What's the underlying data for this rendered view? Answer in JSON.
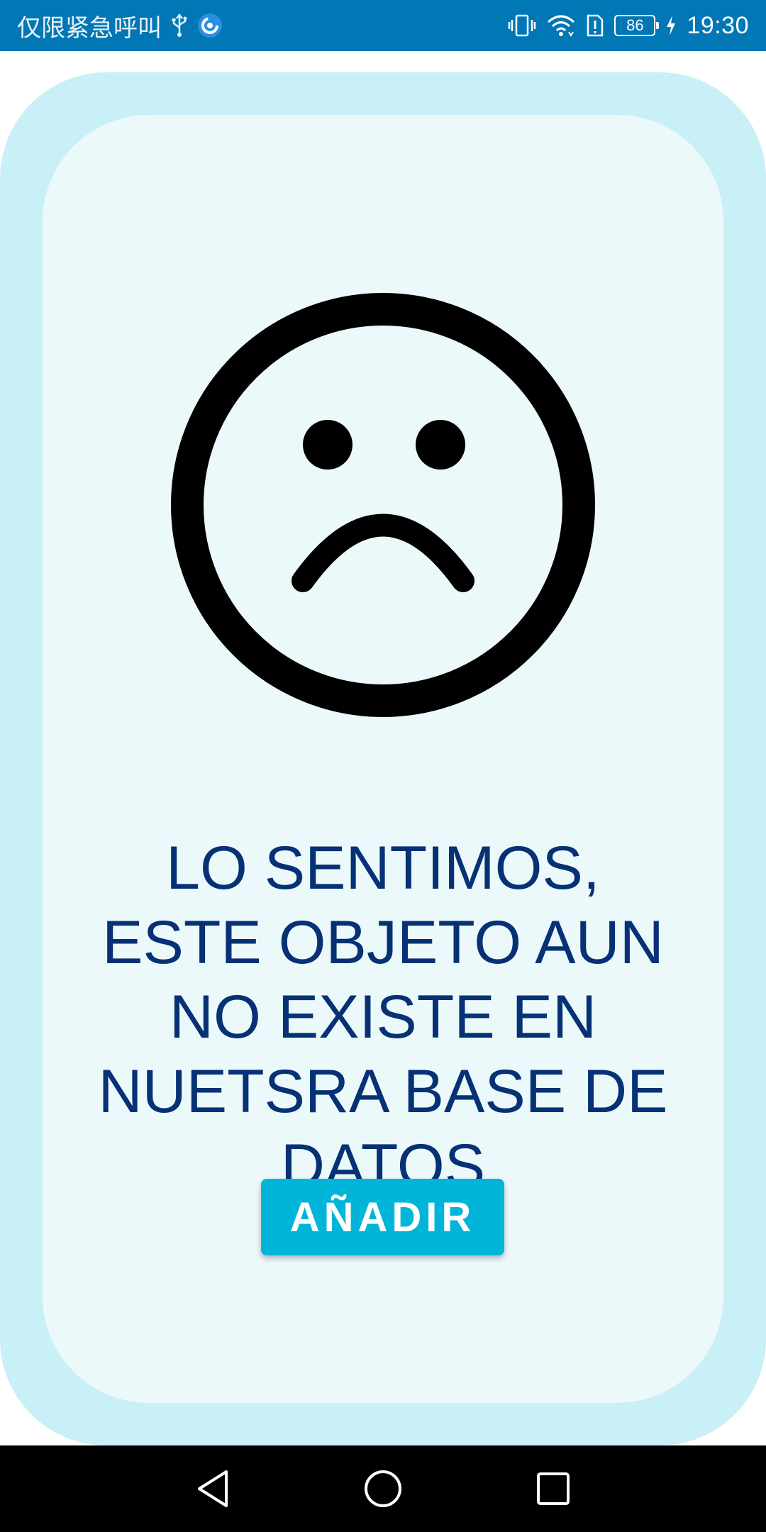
{
  "status_bar": {
    "carrier_text": "仅限紧急呼叫",
    "battery_level": "86",
    "time": "19:30",
    "background_color": "#0177b5",
    "icons": [
      "usb-icon",
      "app-notification-icon",
      "vibrate-icon",
      "wifi-icon",
      "sim-alert-icon",
      "battery-icon",
      "charging-icon"
    ]
  },
  "card": {
    "outer_color": "#c9eff7",
    "inner_color": "#ecf9fb",
    "illustration": "sad-face-icon",
    "message_lines": [
      "LO SENTIMOS,",
      "ESTE OBJETO AUN",
      "NO EXISTE EN",
      "NUETSRA BASE DE",
      "DATOS"
    ],
    "message_color": "#063174",
    "add_button_label": "AÑADIR",
    "add_button_color": "#00b5d8"
  },
  "nav_bar": {
    "buttons": [
      "back-icon",
      "home-icon",
      "recents-icon"
    ]
  }
}
